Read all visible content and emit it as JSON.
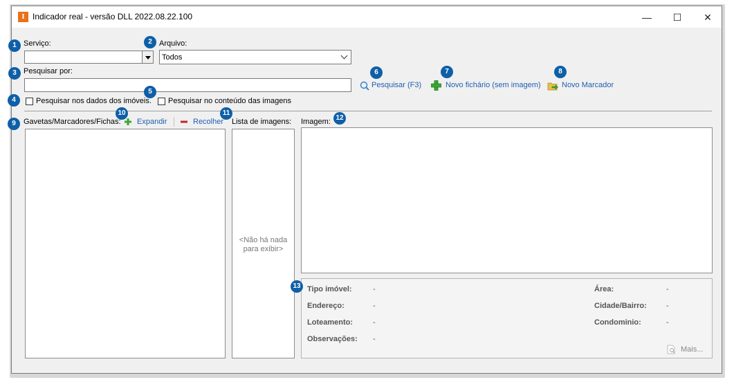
{
  "window": {
    "title": "Indicador real - versão DLL 2022.08.22.100",
    "app_icon_letter": "I",
    "minimize": "—",
    "maximize": "☐",
    "close": "✕"
  },
  "form": {
    "servico_label": "Serviço:",
    "servico_value": "",
    "arquivo_label": "Arquivo:",
    "arquivo_value": "Todos",
    "pesquisar_por_label": "Pesquisar por:",
    "pesquisar_por_value": "",
    "chk_dados_imoveis": "Pesquisar nos dados dos imóveis.",
    "chk_conteudo_imagens": "Pesquisar no conteúdo das imagens"
  },
  "actions": {
    "pesquisar": "Pesquisar (F3)",
    "novo_fichario": "Novo fichário (sem imagem)",
    "novo_marcador": "Novo Marcador"
  },
  "tree": {
    "label": "Gavetas/Marcadores/Fichas:",
    "expandir": "Expandir",
    "recolher": "Recolher"
  },
  "images_list": {
    "label": "Lista de imagens:",
    "empty_line1": "<Não há nada",
    "empty_line2": "para exibir>"
  },
  "image": {
    "label": "Imagem:"
  },
  "info": {
    "tipo_imovel_label": "Tipo imóvel:",
    "tipo_imovel_value": "-",
    "endereco_label": "Endereço:",
    "endereco_value": "-",
    "loteamento_label": "Loteamento:",
    "loteamento_value": "-",
    "observacoes_label": "Observações:",
    "observacoes_value": "-",
    "area_label": "Área:",
    "area_value": "-",
    "cidade_bairro_label": "Cidade/Bairro:",
    "cidade_bairro_value": "-",
    "condominio_label": "Condominio:",
    "condominio_value": "-",
    "mais": "Mais..."
  },
  "badges": [
    "1",
    "2",
    "3",
    "4",
    "5",
    "6",
    "7",
    "8",
    "9",
    "10",
    "11",
    "12",
    "13"
  ],
  "colors": {
    "badge": "#0f5fa8",
    "link": "#1f5fb0",
    "app_icon": "#e8721c",
    "add_icon": "#3aa832",
    "remove_icon": "#d02020"
  }
}
